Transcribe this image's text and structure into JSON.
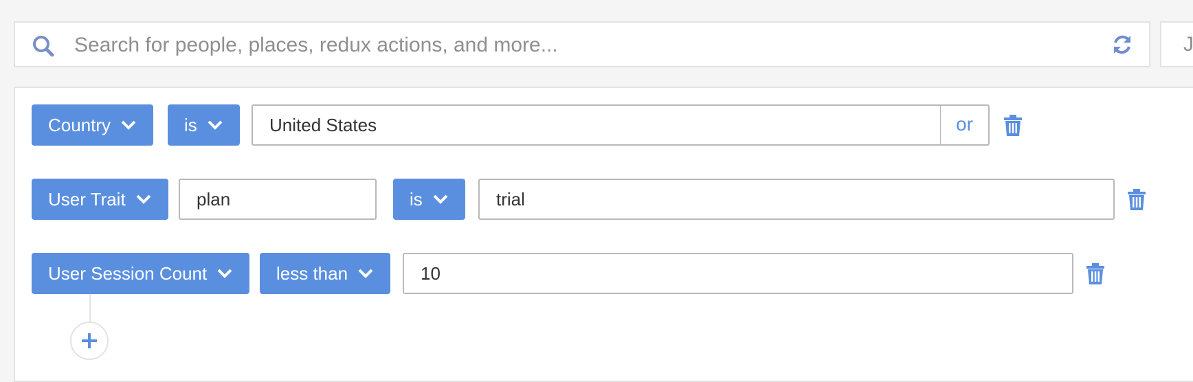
{
  "search": {
    "placeholder": "Search for people, places, redux actions, and more...",
    "side_box_text": "J"
  },
  "filters": [
    {
      "field_label": "Country",
      "operator_label": "is",
      "value": "United States",
      "or_label": "or"
    },
    {
      "field_label": "User Trait",
      "trait_name": "plan",
      "operator_label": "is",
      "value": "trial"
    },
    {
      "field_label": "User Session Count",
      "operator_label": "less than",
      "value": "10"
    }
  ],
  "colors": {
    "accent": "#5a8fe0",
    "background": "#f5f5f5",
    "border": "#b9b9b9",
    "placeholder": "#8f8f8f"
  },
  "icons": {
    "search": "search-icon",
    "refresh": "refresh-icon",
    "chevron": "chevron-down-icon",
    "delete": "trash-icon",
    "add": "plus-icon"
  }
}
